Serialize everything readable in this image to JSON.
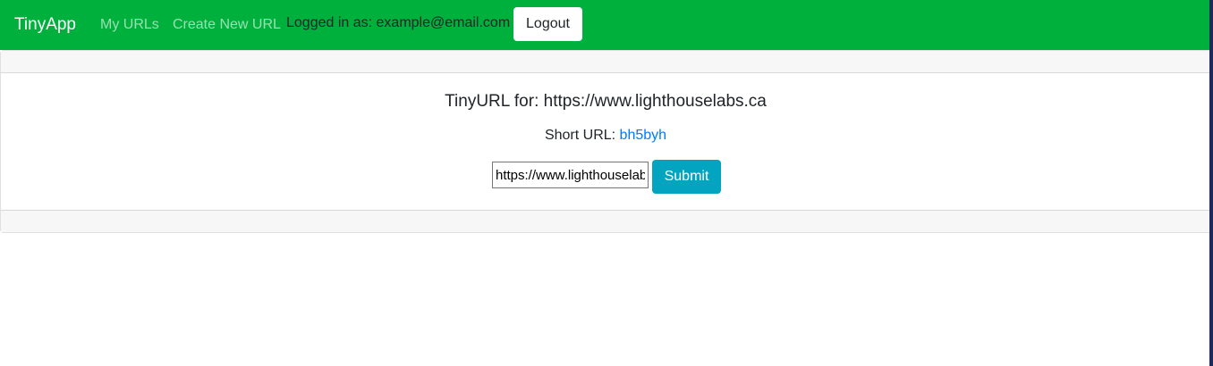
{
  "navbar": {
    "brand": "TinyApp",
    "links": {
      "my_urls": "My URLs",
      "create_new_url": "Create New URL"
    },
    "logged_in_text": "Logged in as: example@email.com",
    "logout_label": "Logout",
    "background_color": "#00b03c"
  },
  "card": {
    "title": "TinyURL for: https://www.lighthouselabs.ca",
    "short_url_label": "Short URL: ",
    "short_url_value": "bh5byh",
    "long_url_input_value": "https://www.lighthouselabs.ca",
    "submit_label": "Submit",
    "submit_color": "#02a4bf",
    "link_color": "#007bff"
  }
}
